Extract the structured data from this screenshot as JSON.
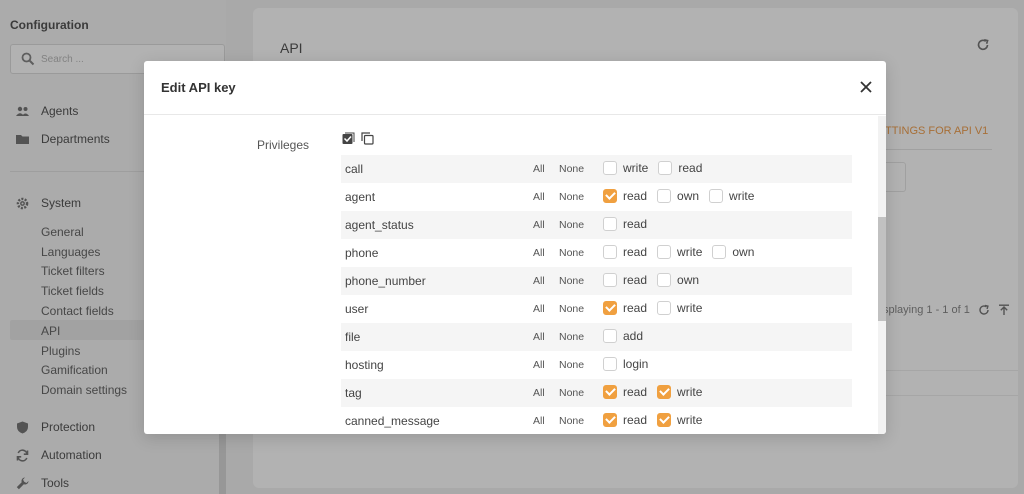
{
  "sidebar": {
    "title": "Configuration",
    "search_placeholder": "Search ...",
    "items": [
      {
        "label": "Agents",
        "icon": "users-icon"
      },
      {
        "label": "Departments",
        "icon": "folder-icon"
      }
    ],
    "system": {
      "label": "System",
      "icon": "gear-icon",
      "subitems": [
        "General",
        "Languages",
        "Ticket filters",
        "Ticket fields",
        "Contact fields",
        "API",
        "Plugins",
        "Gamification",
        "Domain settings"
      ],
      "active": "API"
    },
    "bottom_items": [
      {
        "label": "Protection",
        "icon": "shield-icon"
      },
      {
        "label": "Automation",
        "icon": "sync-icon"
      },
      {
        "label": "Tools",
        "icon": "wrench-icon"
      }
    ]
  },
  "main": {
    "title": "API",
    "settings_link": "TTINGS FOR API V1",
    "displaying": "splaying 1 - 1 of 1"
  },
  "modal": {
    "title": "Edit API key",
    "privileges_label": "Privileges",
    "all_label": "All",
    "none_label": "None",
    "rows": [
      {
        "name": "call",
        "perms": [
          {
            "label": "write",
            "checked": false
          },
          {
            "label": "read",
            "checked": false
          }
        ]
      },
      {
        "name": "agent",
        "perms": [
          {
            "label": "read",
            "checked": true
          },
          {
            "label": "own",
            "checked": false
          },
          {
            "label": "write",
            "checked": false
          }
        ]
      },
      {
        "name": "agent_status",
        "perms": [
          {
            "label": "read",
            "checked": false
          }
        ]
      },
      {
        "name": "phone",
        "perms": [
          {
            "label": "read",
            "checked": false
          },
          {
            "label": "write",
            "checked": false
          },
          {
            "label": "own",
            "checked": false
          }
        ]
      },
      {
        "name": "phone_number",
        "perms": [
          {
            "label": "read",
            "checked": false
          },
          {
            "label": "own",
            "checked": false
          }
        ]
      },
      {
        "name": "user",
        "perms": [
          {
            "label": "read",
            "checked": true
          },
          {
            "label": "write",
            "checked": false
          }
        ]
      },
      {
        "name": "file",
        "perms": [
          {
            "label": "add",
            "checked": false
          }
        ]
      },
      {
        "name": "hosting",
        "perms": [
          {
            "label": "login",
            "checked": false
          }
        ]
      },
      {
        "name": "tag",
        "perms": [
          {
            "label": "read",
            "checked": true
          },
          {
            "label": "write",
            "checked": true
          }
        ]
      },
      {
        "name": "canned_message",
        "perms": [
          {
            "label": "read",
            "checked": true
          },
          {
            "label": "write",
            "checked": true
          }
        ]
      }
    ]
  },
  "colors": {
    "accent": "#f0a040"
  }
}
